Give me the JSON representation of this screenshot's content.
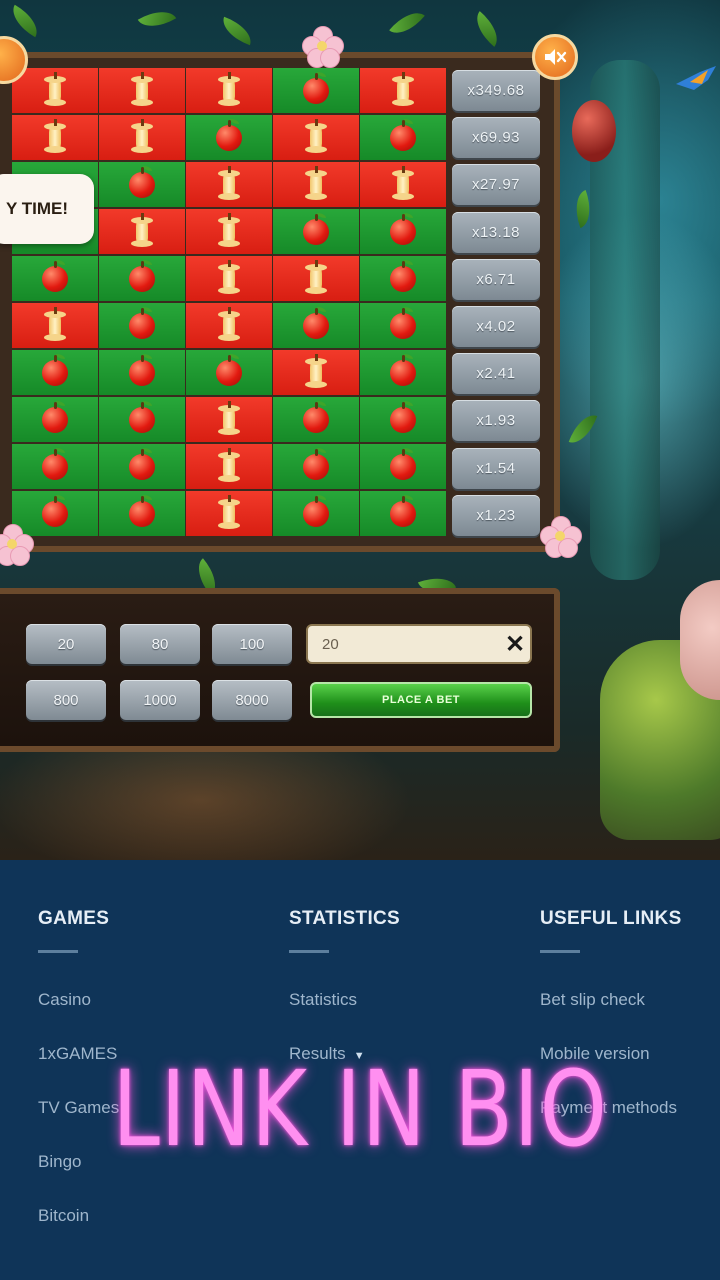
{
  "game": {
    "banner_text": "Y TIME!",
    "board": [
      [
        "core",
        "core",
        "core",
        "apple",
        "core"
      ],
      [
        "core",
        "core",
        "apple",
        "core",
        "apple"
      ],
      [
        "",
        "apple",
        "core",
        "core",
        "core"
      ],
      [
        "",
        "core",
        "core",
        "apple",
        "apple"
      ],
      [
        "apple",
        "apple",
        "core",
        "core",
        "apple"
      ],
      [
        "core",
        "apple",
        "core",
        "apple",
        "apple"
      ],
      [
        "apple",
        "apple",
        "apple",
        "core",
        "apple"
      ],
      [
        "apple",
        "apple",
        "core",
        "apple",
        "apple"
      ],
      [
        "apple",
        "apple",
        "core",
        "apple",
        "apple"
      ],
      [
        "apple",
        "apple",
        "core",
        "apple",
        "apple"
      ]
    ],
    "multipliers": [
      "x349.68",
      "x69.93",
      "x27.97",
      "x13.18",
      "x6.71",
      "x4.02",
      "x2.41",
      "x1.93",
      "x1.54",
      "x1.23"
    ],
    "colors": {
      "red_cell": "#e52a1c",
      "green_cell": "#1f9a30",
      "place_bet": "#2aa823"
    }
  },
  "bet_panel": {
    "chips_row1": [
      "20",
      "80",
      "100"
    ],
    "chips_row2": [
      "800",
      "1000",
      "8000"
    ],
    "bet_value": "20",
    "clear_label": "✕",
    "place_bet_label": "PLACE A BET"
  },
  "footer": {
    "columns": [
      {
        "title": "GAMES",
        "links": [
          "Casino",
          "1xGAMES",
          "TV Games",
          "Bingo",
          "Bitcoin"
        ]
      },
      {
        "title": "STATISTICS",
        "links": [
          "Statistics",
          "Results"
        ]
      },
      {
        "title": "USEFUL LINKS",
        "links": [
          "Bet slip check",
          "Mobile version",
          "Payment methods"
        ]
      }
    ]
  },
  "overlay_text": "LINK IN BIO"
}
